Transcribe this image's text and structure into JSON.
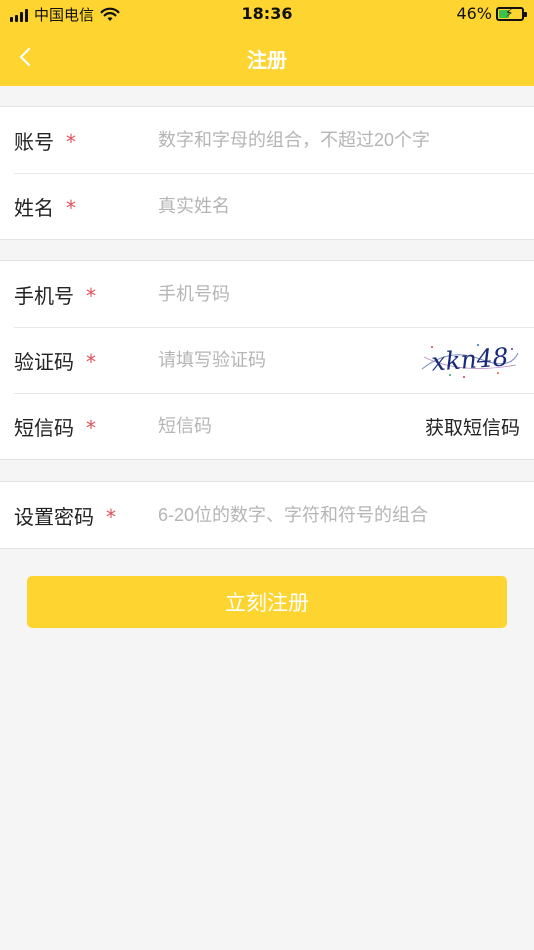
{
  "status_bar": {
    "carrier": "中国电信",
    "time": "18:36",
    "battery": "46%",
    "battery_level": 0.46
  },
  "nav": {
    "title": "注册"
  },
  "form": {
    "account": {
      "label": "账号",
      "required": "*",
      "placeholder": "数字和字母的组合，不超过20个字"
    },
    "name": {
      "label": "姓名",
      "required": "*",
      "placeholder": "真实姓名"
    },
    "phone": {
      "label": "手机号",
      "required": "*",
      "placeholder": "手机号码"
    },
    "captcha": {
      "label": "验证码",
      "required": "*",
      "placeholder": "请填写验证码",
      "image_text": "xkn48"
    },
    "sms": {
      "label": "短信码",
      "required": "*",
      "placeholder": "短信码",
      "button": "获取短信码"
    },
    "password": {
      "label": "设置密码",
      "required": "*",
      "placeholder": "6-20位的数字、字符和符号的组合"
    }
  },
  "submit_label": "立刻注册",
  "colors": {
    "brand": "#fed530",
    "required_star": "#e0505a",
    "placeholder": "#b5b5b5"
  }
}
